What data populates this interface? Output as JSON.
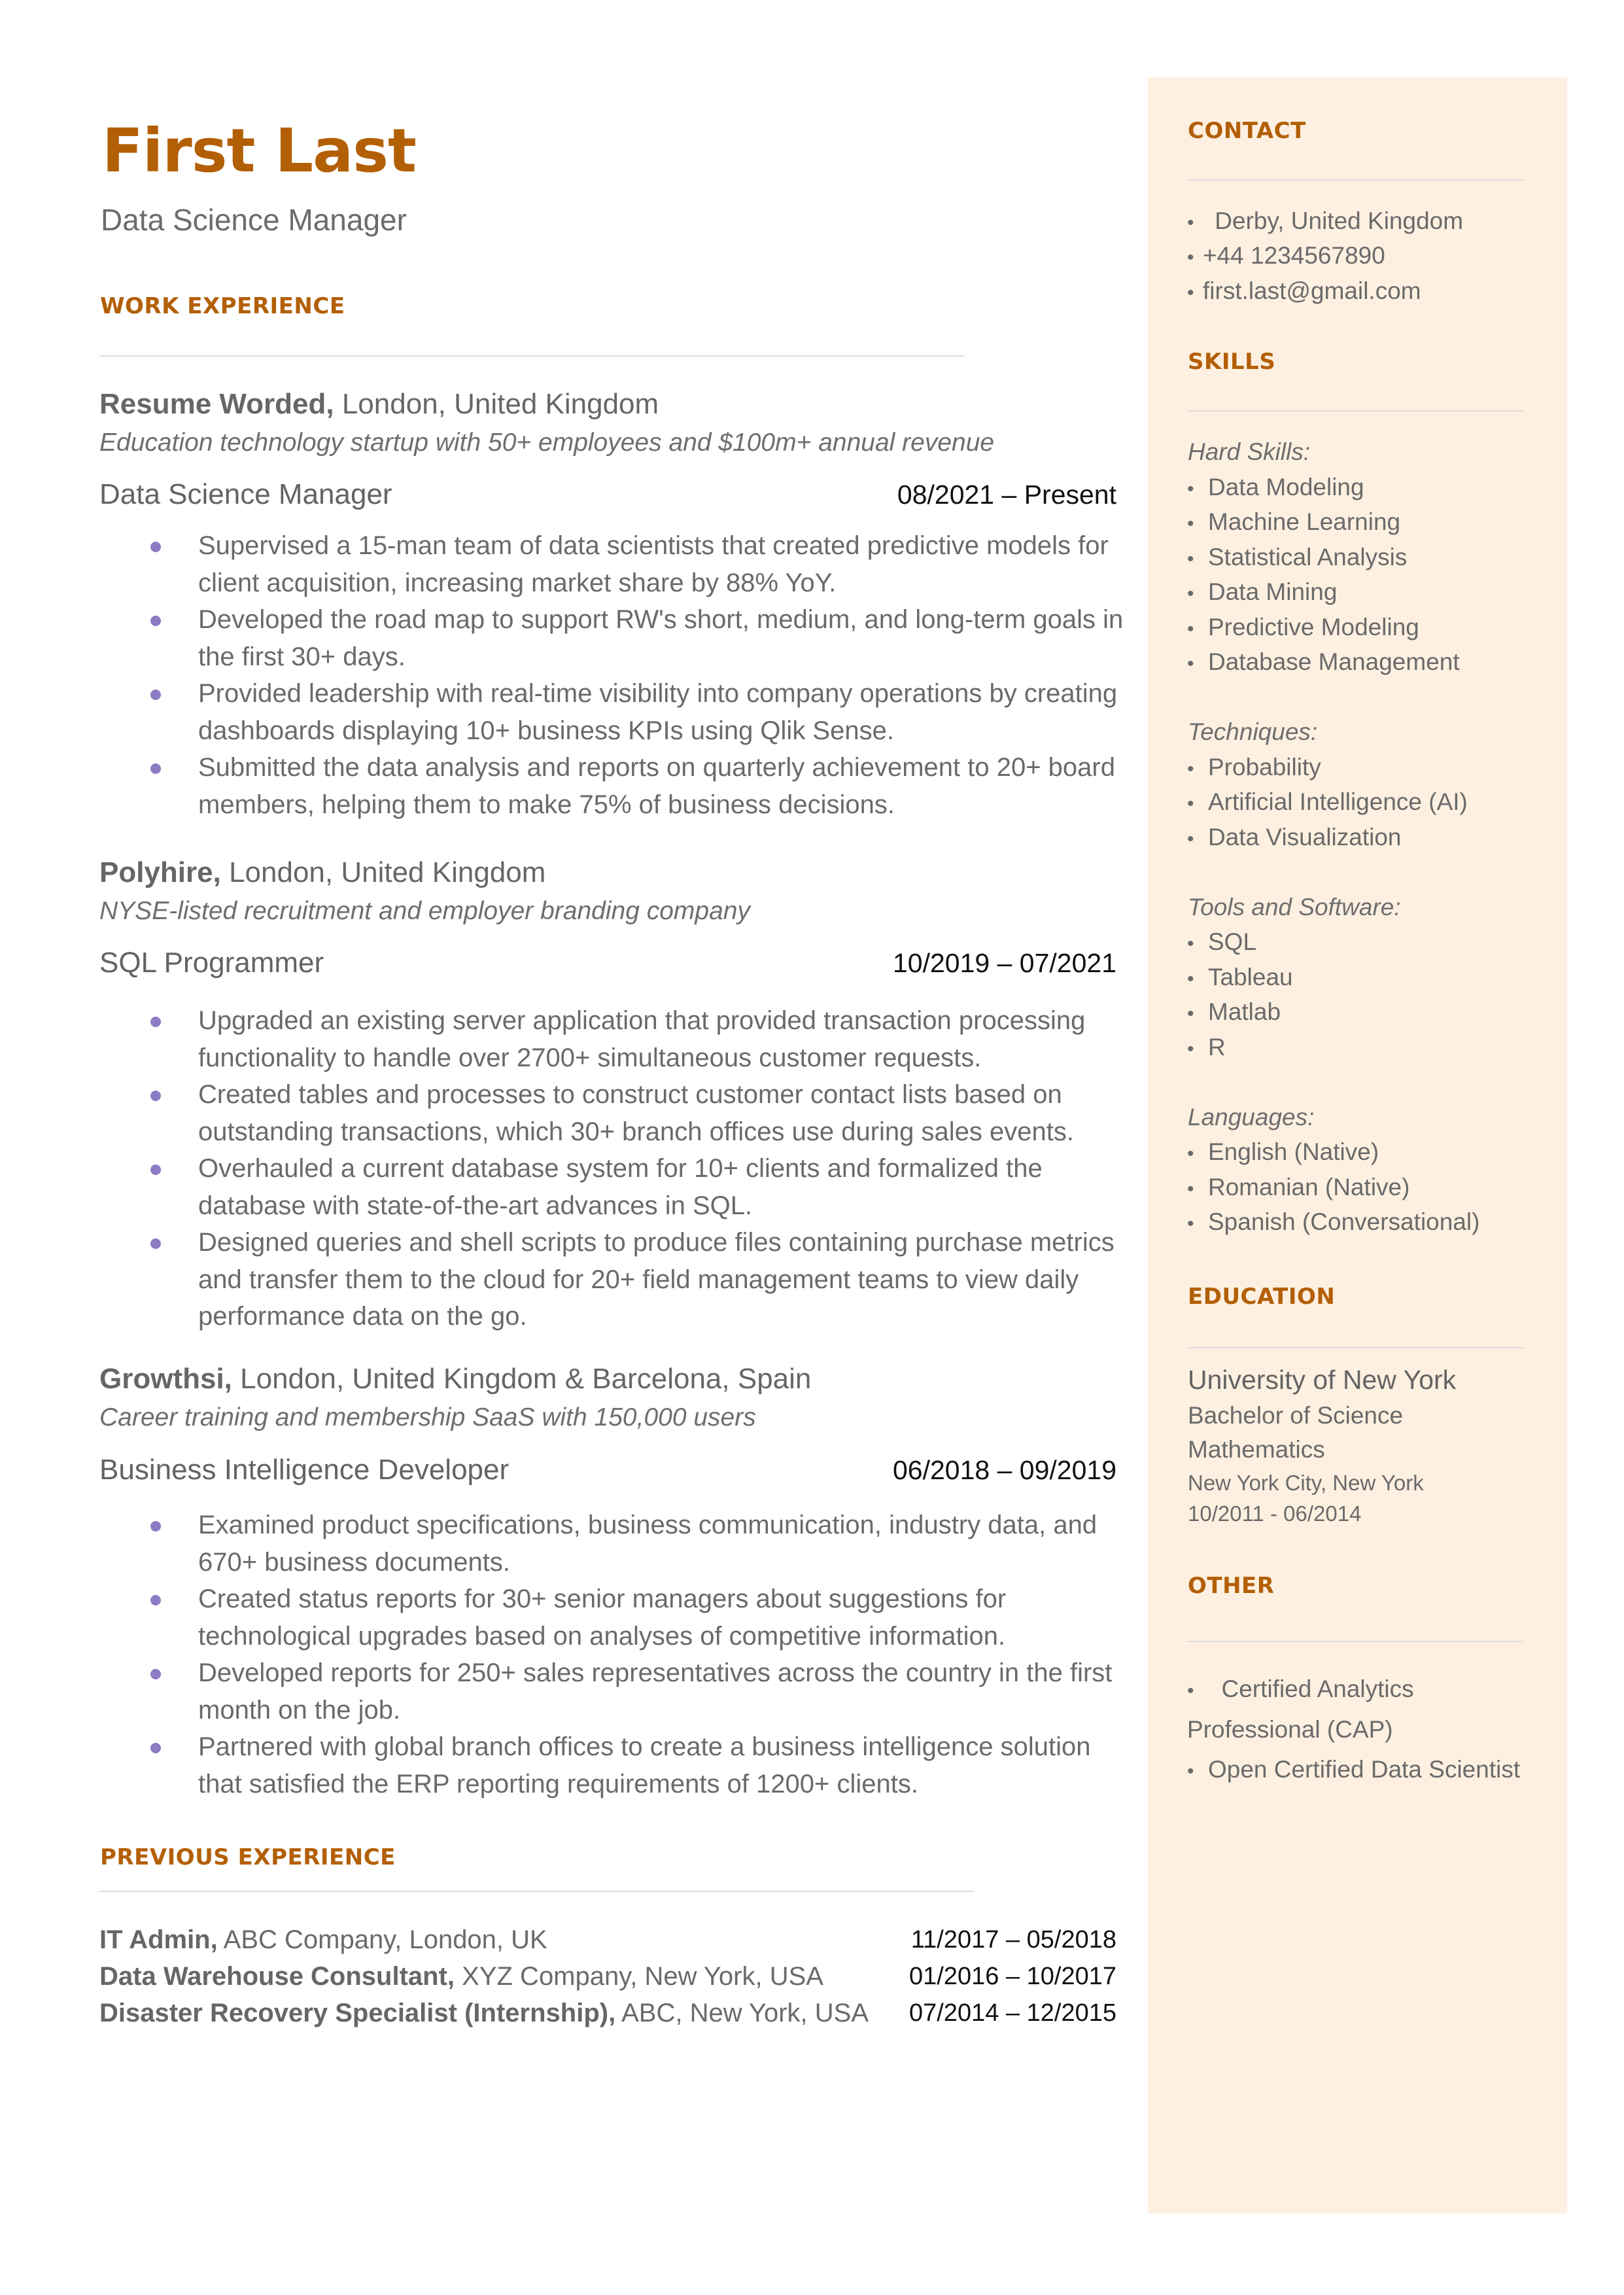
{
  "header": {
    "name": "First Last",
    "title": "Data Science Manager"
  },
  "colors": {
    "accent": "#B35F05",
    "bullet": "#8C7CC3",
    "sidebar_bg": "#FEF0E1",
    "text": "#666666"
  },
  "work": {
    "heading": "WORK EXPERIENCE",
    "entries": [
      {
        "company": "Resume Worded,",
        "location": " London, United Kingdom",
        "description": "Education technology startup with 50+ employees and $100m+ annual revenue",
        "role": "Data Science Manager",
        "dates": "08/2021 – Present",
        "bullets": [
          "Supervised a 15-man team of data scientists that created predictive models for client acquisition, increasing market share by 88% YoY.",
          "Developed the road map to support RW's short, medium, and long-term goals in the first 30+ days.",
          "Provided leadership with real-time visibility into company operations by creating dashboards displaying 10+ business KPIs using Qlik Sense.",
          "Submitted the data analysis and reports on quarterly achievement to 20+ board members, helping them to make 75% of business decisions."
        ]
      },
      {
        "company": "Polyhire,",
        "location": " London, United Kingdom",
        "description": "NYSE-listed recruitment and employer branding company",
        "role": "SQL Programmer",
        "dates": "10/2019 – 07/2021",
        "bullets": [
          "Upgraded an existing server application that provided transaction processing functionality to handle over 2700+ simultaneous customer requests.",
          "Created tables and processes to construct customer contact lists based on outstanding transactions, which 30+ branch offices use during sales events.",
          "Overhauled a current database system for 10+ clients and formalized the database with state-of-the-art advances in SQL.",
          "Designed queries and shell scripts to produce files containing purchase metrics and transfer them to the cloud for 20+ field management teams to view daily performance data on the go."
        ]
      },
      {
        "company": "Growthsi,",
        "location": " London, United Kingdom & Barcelona, Spain",
        "description": "Career training and membership SaaS with 150,000 users",
        "role": "Business Intelligence Developer",
        "dates": "06/2018 – 09/2019",
        "bullets": [
          "Examined product specifications, business communication, industry data, and 670+ business documents.",
          "Created status reports for 30+ senior managers about suggestions for technological upgrades based on analyses of competitive information.",
          "Developed reports for 250+ sales representatives across the country in the first month on the job.",
          "Partnered with global branch offices to create a business intelligence solution that satisfied the ERP reporting requirements of 1200+ clients."
        ]
      }
    ]
  },
  "previous": {
    "heading": "PREVIOUS EXPERIENCE",
    "entries": [
      {
        "role": "IT Admin,",
        "detail": " ABC Company, London, UK",
        "dates": "11/2017 – 05/2018"
      },
      {
        "role": "Data Warehouse Consultant,",
        "detail": " XYZ Company, New York, USA",
        "dates": "01/2016 – 10/2017"
      },
      {
        "role": "Disaster Recovery Specialist (Internship),",
        "detail": " ABC, New York, USA",
        "dates": "07/2014 – 12/2015"
      }
    ]
  },
  "sidebar": {
    "contact": {
      "heading": "CONTACT",
      "items": [
        " Derby, United Kingdom",
        "+44 1234567890",
        "first.last@gmail.com"
      ]
    },
    "skills": {
      "heading": "SKILLS",
      "groups": [
        {
          "label": "Hard Skills:",
          "items": [
            "Data Modeling",
            "Machine Learning",
            "Statistical Analysis",
            "Data Mining",
            "Predictive Modeling",
            "Database Management"
          ]
        },
        {
          "label": "Techniques:",
          "items": [
            "Probability",
            "Artificial Intelligence (AI)",
            "Data Visualization"
          ]
        },
        {
          "label": "Tools and Software:",
          "items": [
            "SQL",
            "Tableau",
            "Matlab",
            "R"
          ]
        },
        {
          "label": "Languages:",
          "items": [
            "English (Native)",
            "Romanian (Native)",
            "Spanish (Conversational)"
          ]
        }
      ]
    },
    "education": {
      "heading": "EDUCATION",
      "school": "University of New York",
      "degree": "Bachelor of Science",
      "field": "Mathematics",
      "location": "New York City, New York",
      "dates": "10/2011 - 06/2014"
    },
    "other": {
      "heading": "OTHER",
      "items": [
        "  Certified Analytics",
        "Professional (CAP)",
        "Open Certified Data Scientist"
      ]
    }
  }
}
